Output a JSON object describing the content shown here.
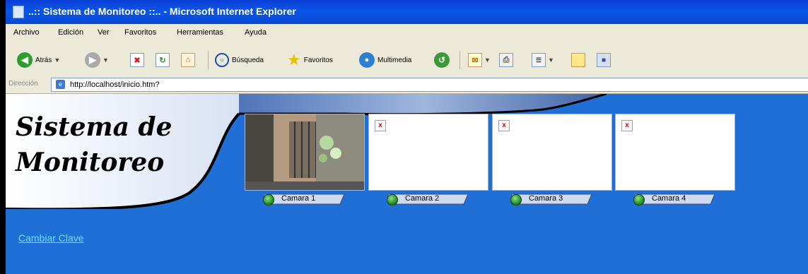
{
  "window": {
    "title": "..:: Sistema de Monitoreo ::.. - Microsoft Internet Explorer"
  },
  "menubar": {
    "items": [
      "Archivo",
      "Edición",
      "Ver",
      "Favoritos",
      "Herramientas",
      "Ayuda"
    ]
  },
  "toolbar": {
    "back": "Atrás",
    "search": "Búsqueda",
    "favorites": "Favoritos",
    "multimedia": "Multimedia"
  },
  "address": {
    "label": "Dirección",
    "url": "http://localhost/inicio.htm?"
  },
  "page": {
    "banner_line1": "Sistema de",
    "banner_line2": "Monitoreo",
    "cameras": [
      {
        "label": "Camara 1",
        "has_image": true
      },
      {
        "label": "Camara 2",
        "has_image": false
      },
      {
        "label": "Camara 3",
        "has_image": false
      },
      {
        "label": "Camara 4",
        "has_image": false
      }
    ],
    "change_password": "Cambiar Clave"
  },
  "colors": {
    "page_bg": "#1f6fd6",
    "titlebar": "#0a55e8",
    "chrome": "#ece9d8",
    "link": "#6fe0ff"
  }
}
